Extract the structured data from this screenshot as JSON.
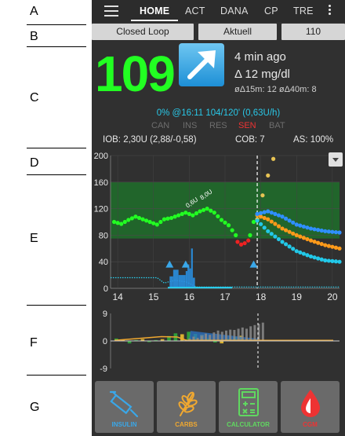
{
  "annotations": [
    "A",
    "B",
    "C",
    "D",
    "E",
    "F",
    "G"
  ],
  "tabs": [
    {
      "label": "HOME",
      "active": true
    },
    {
      "label": "ACT",
      "active": false
    },
    {
      "label": "DANA",
      "active": false
    },
    {
      "label": "CP",
      "active": false
    },
    {
      "label": "TRE",
      "active": false
    }
  ],
  "pills": {
    "loop": "Closed Loop",
    "profile": "Aktuell",
    "target": "110"
  },
  "bg": {
    "value": "109",
    "ago": "4 min ago",
    "delta": "Δ 12 mg/dl",
    "avg_delta": "øΔ15m: 12  øΔ40m: 8",
    "trend_icon": "arrow-up-right-icon",
    "color": "#22ff22"
  },
  "tbr": "0% @16:11 104/120' (0,63U/h)",
  "status": {
    "can": "CAN",
    "ins": "INS",
    "res": "RES",
    "sen": "SEN",
    "bat": "BAT"
  },
  "iob": {
    "iob": "IOB: 2,30U (2,88/-0,58)",
    "cob": "COB: 7",
    "as": "AS: 100%"
  },
  "chart_data": [
    {
      "type": "line",
      "title": "",
      "xlabel": "",
      "ylabel": "",
      "x_ticks": [
        "14",
        "15",
        "16",
        "17",
        "18",
        "19",
        "20"
      ],
      "y_ticks": [
        "0",
        "40",
        "80",
        "120",
        "160",
        "200"
      ],
      "ylim": [
        0,
        200
      ],
      "xlim": [
        13.8,
        20.2
      ],
      "target_range": [
        75,
        160
      ],
      "now": 17.9,
      "smb_label": "0,6U",
      "smb_label2": "8,0U",
      "series": [
        {
          "name": "",
          "color": "#22ff22",
          "values": [
            [
              13.9,
              100
            ],
            [
              14.1,
              97
            ],
            [
              14.3,
              103
            ],
            [
              14.5,
              108
            ],
            [
              14.7,
              104
            ],
            [
              14.9,
              100
            ],
            [
              15.1,
              96
            ],
            [
              15.3,
              104
            ],
            [
              15.5,
              106
            ],
            [
              15.7,
              110
            ],
            [
              15.9,
              114
            ],
            [
              16.1,
              110
            ],
            [
              16.3,
              116
            ],
            [
              16.5,
              120
            ],
            [
              16.7,
              114
            ],
            [
              16.9,
              103
            ],
            [
              17.1,
              95
            ],
            [
              17.3,
              80
            ]
          ]
        },
        {
          "name": "",
          "color": "#ee2222",
          "values": [
            [
              17.35,
              70
            ],
            [
              17.45,
              66
            ],
            [
              17.55,
              68
            ],
            [
              17.65,
              72
            ]
          ]
        },
        {
          "name": "",
          "color": "#22ff22",
          "values": [
            [
              17.7,
              80
            ],
            [
              17.8,
              100
            ]
          ]
        },
        {
          "name": "",
          "color": "#e8c454",
          "values": [
            [
              17.9,
              104
            ],
            [
              18.05,
              140
            ],
            [
              18.2,
              170
            ],
            [
              18.35,
              195
            ]
          ]
        },
        {
          "name": "",
          "color": "#ff9a1a",
          "values": [
            [
              17.9,
              110
            ],
            [
              18.2,
              104
            ],
            [
              18.6,
              90
            ],
            [
              19.0,
              80
            ],
            [
              19.4,
              72
            ],
            [
              19.8,
              65
            ],
            [
              20.2,
              60
            ]
          ]
        },
        {
          "name": "",
          "color": "#2f8fff",
          "values": [
            [
              17.9,
              112
            ],
            [
              18.2,
              116
            ],
            [
              18.6,
              108
            ],
            [
              19.0,
              96
            ],
            [
              19.4,
              90
            ],
            [
              19.8,
              86
            ],
            [
              20.2,
              84
            ]
          ]
        },
        {
          "name": "",
          "color": "#22c8e8",
          "values": [
            [
              17.9,
              102
            ],
            [
              18.2,
              86
            ],
            [
              18.6,
              70
            ],
            [
              19.0,
              56
            ],
            [
              19.4,
              48
            ],
            [
              19.8,
              42
            ],
            [
              20.2,
              40
            ]
          ]
        }
      ],
      "smb_markers": [
        15.45,
        15.9,
        17.8
      ],
      "basal": [
        [
          13.8,
          16
        ],
        [
          15.1,
          16
        ],
        [
          15.3,
          8
        ],
        [
          15.6,
          12
        ],
        [
          15.9,
          10
        ],
        [
          16.2,
          2
        ],
        [
          17.2,
          2
        ]
      ],
      "bolus": [
        [
          15.45,
          18
        ],
        [
          15.55,
          28
        ],
        [
          15.7,
          20
        ],
        [
          15.9,
          26
        ],
        [
          15.95,
          36
        ],
        [
          16.0,
          30
        ],
        [
          16.05,
          60
        ],
        [
          16.1,
          16
        ]
      ]
    },
    {
      "type": "bar",
      "title": "",
      "xlabel": "",
      "ylabel": "",
      "y_ticks": [
        "9",
        "0",
        "-9"
      ],
      "ylim": [
        -9,
        9
      ],
      "xlim": [
        13.8,
        20.2
      ],
      "devs_green": [
        0.8,
        0.4,
        -0.8,
        0.3,
        0.6,
        -0.4,
        0.3,
        0.6,
        1.6,
        2.5,
        2.2,
        3.0,
        2.3,
        2.0,
        0.9,
        -0.5,
        -0.8,
        0.7,
        1.2,
        1.7
      ],
      "devs_yellow": [
        0,
        0,
        0,
        0,
        0,
        0,
        0,
        0,
        0,
        0,
        0,
        0,
        0,
        0,
        0,
        0,
        0,
        0,
        0,
        0
      ],
      "devs_grey": [
        0.5,
        0.8,
        1.4,
        1.0,
        1.6,
        2.4,
        2.0,
        2.8,
        3.4,
        3.0,
        3.4,
        3.7,
        3.6,
        4.0,
        4.4,
        4.0,
        4.8,
        5.2,
        5.6,
        6.0
      ]
    }
  ],
  "buttons": [
    {
      "label": "INSULIN",
      "color": "#3aa7e8",
      "icon": "syringe-icon"
    },
    {
      "label": "CARBS",
      "color": "#f0a830",
      "icon": "wheat-icon"
    },
    {
      "label": "CALCULATOR",
      "color": "#60d860",
      "icon": "calculator-icon"
    },
    {
      "label": "CGM",
      "color": "#ee3333",
      "icon": "blood-drop-icon"
    }
  ]
}
